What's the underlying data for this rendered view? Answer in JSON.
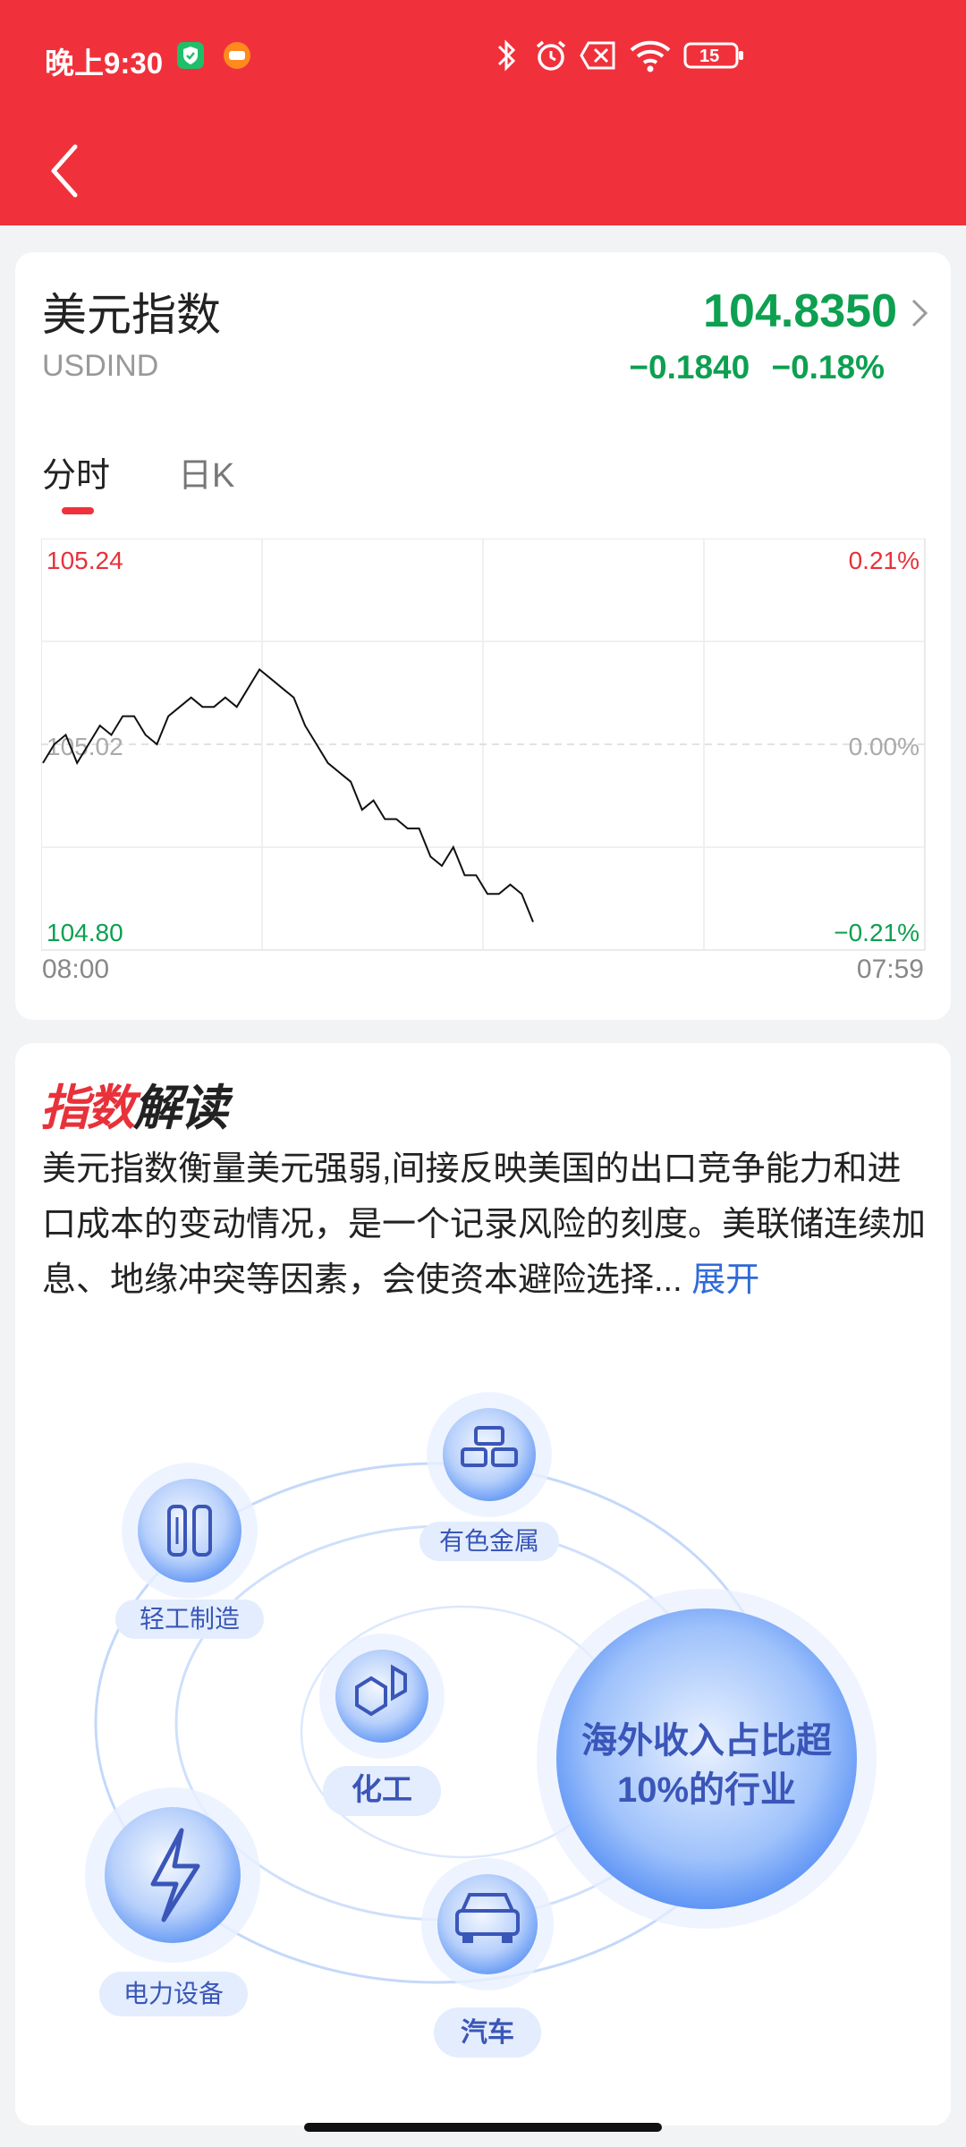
{
  "status_bar": {
    "time": "晚上9:30",
    "battery": "15"
  },
  "index": {
    "name": "美元指数",
    "code": "USDIND",
    "price": "104.8350",
    "change": "−0.1840",
    "change_pct": "−0.18%",
    "colors": {
      "up": "#e8313a",
      "down": "#0ca050",
      "brand": "#f0313b"
    }
  },
  "tabs": [
    {
      "label": "分时",
      "active": true
    },
    {
      "label": "日K",
      "active": false
    }
  ],
  "chart_data": {
    "type": "line",
    "y_left_labels": {
      "top": "105.24",
      "mid": "105.02",
      "bottom": "104.80"
    },
    "y_right_labels": {
      "top": "0.21%",
      "mid": "0.00%",
      "bottom": "−0.21%"
    },
    "x_labels": [
      "08:00",
      "07:59"
    ],
    "ylim": [
      104.8,
      105.24
    ],
    "reference": 105.02,
    "series": [
      {
        "values": [
          105.0,
          105.02,
          105.03,
          105.0,
          105.02,
          105.04,
          105.03,
          105.05,
          105.05,
          105.03,
          105.02,
          105.05,
          105.06,
          105.07,
          105.06,
          105.06,
          105.07,
          105.06,
          105.08,
          105.1,
          105.09,
          105.08,
          105.07,
          105.04,
          105.02,
          105.0,
          104.99,
          104.98,
          104.95,
          104.96,
          104.94,
          104.94,
          104.93,
          104.93,
          104.9,
          104.89,
          104.91,
          104.88,
          104.88,
          104.86,
          104.86,
          104.87,
          104.86,
          104.83
        ]
      }
    ]
  },
  "interpretation": {
    "title_a": "指数",
    "title_b": "解读",
    "text": "美元指数衡量美元强弱,间接反映美国的出口竞争能力和进口成本的变动情况，是一个记录风险的刻度。美联储连续加息、地缘冲突等因素，会使资本避险选择...",
    "more": "展开",
    "illustration": {
      "center_line1": "海外收入占比超",
      "center_line2": "10%的行业",
      "industries": [
        "有色金属",
        "轻工制造",
        "化工",
        "电力设备",
        "汽车"
      ]
    }
  }
}
